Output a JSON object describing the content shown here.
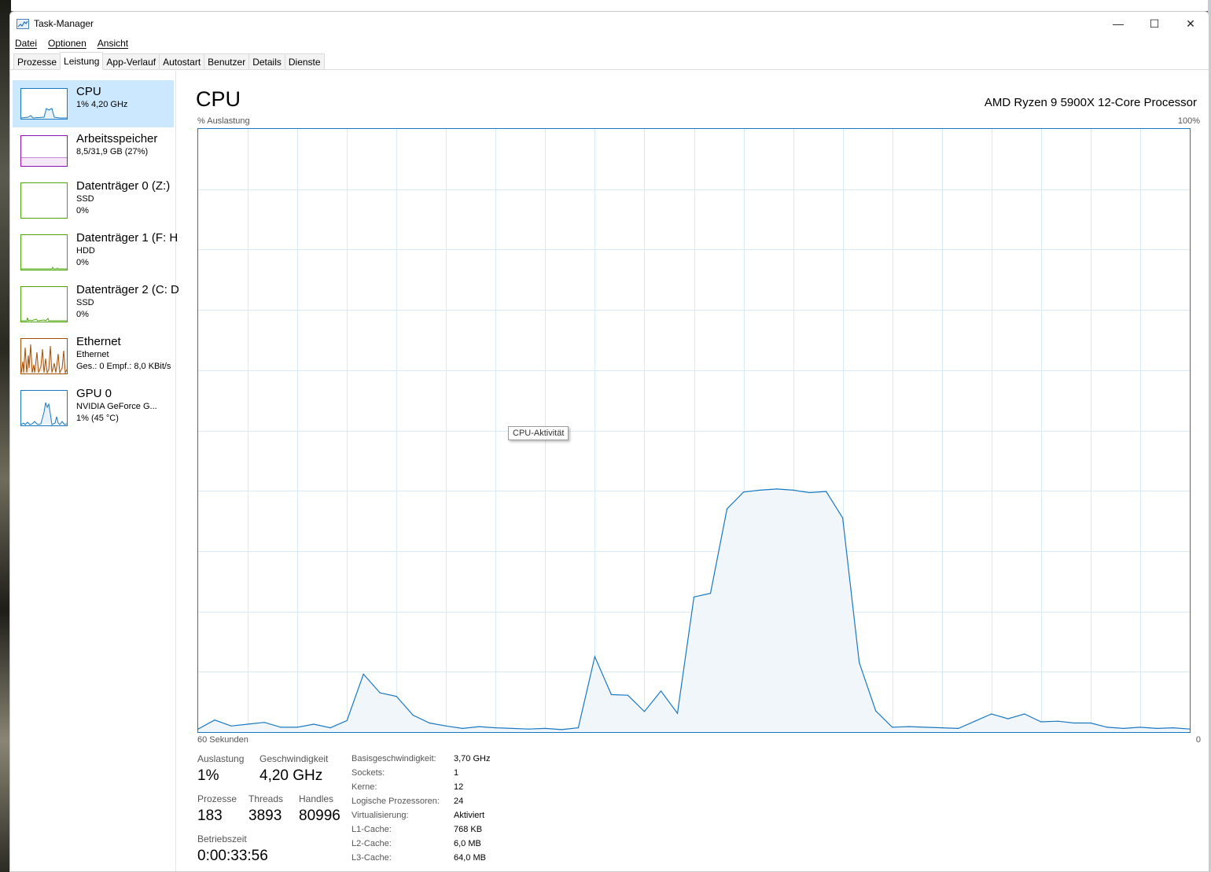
{
  "window": {
    "title": "Task-Manager",
    "controls": {
      "minimize": "—",
      "maximize": "☐",
      "close": "✕"
    }
  },
  "menu": [
    "Datei",
    "Optionen",
    "Ansicht"
  ],
  "tabs": [
    "Prozesse",
    "Leistung",
    "App-Verlauf",
    "Autostart",
    "Benutzer",
    "Details",
    "Dienste"
  ],
  "active_tab": "Leistung",
  "sidebar": {
    "items": [
      {
        "title": "CPU",
        "line1": "1%  4,20 GHz",
        "line2": "",
        "color": "#1978c2",
        "selected": true
      },
      {
        "title": "Arbeitsspeicher",
        "line1": "8,5/31,9 GB (27%)",
        "line2": "",
        "color": "#8b12ae",
        "selected": false
      },
      {
        "title": "Datenträger 0 (Z:)",
        "line1": "SSD",
        "line2": "0%",
        "color": "#4da60c",
        "selected": false
      },
      {
        "title": "Datenträger 1 (F: H",
        "line1": "HDD",
        "line2": "0%",
        "color": "#4da60c",
        "selected": false
      },
      {
        "title": "Datenträger 2 (C: D",
        "line1": "SSD",
        "line2": "0%",
        "color": "#4da60c",
        "selected": false
      },
      {
        "title": "Ethernet",
        "line1": "Ethernet",
        "line2": "Ges.: 0  Empf.: 8,0 KBit/s",
        "color": "#a74f01",
        "selected": false
      },
      {
        "title": "GPU 0",
        "line1": "NVIDIA GeForce G...",
        "line2": "1%  (45 °C)",
        "color": "#1978c2",
        "selected": false
      }
    ]
  },
  "main": {
    "title": "CPU",
    "model": "AMD Ryzen 9 5900X 12-Core Processor",
    "y_axis_label": "% Auslastung",
    "y_axis_max": "100%",
    "x_axis_left": "60 Sekunden",
    "x_axis_right": "0",
    "tooltip": "CPU-Aktivität"
  },
  "stats": {
    "auslastung_label": "Auslastung",
    "auslastung": "1%",
    "geschwindigkeit_label": "Geschwindigkeit",
    "geschwindigkeit": "4,20 GHz",
    "prozesse_label": "Prozesse",
    "prozesse": "183",
    "threads_label": "Threads",
    "threads": "3893",
    "handles_label": "Handles",
    "handles": "80996",
    "betriebszeit_label": "Betriebszeit",
    "betriebszeit": "0:00:33:56"
  },
  "info": [
    {
      "label": "Basisgeschwindigkeit:",
      "value": "3,70 GHz"
    },
    {
      "label": "Sockets:",
      "value": "1"
    },
    {
      "label": "Kerne:",
      "value": "12"
    },
    {
      "label": "Logische Prozessoren:",
      "value": "24"
    },
    {
      "label": "Virtualisierung:",
      "value": "Aktiviert"
    },
    {
      "label": "L1-Cache:",
      "value": "768 KB"
    },
    {
      "label": "L2-Cache:",
      "value": "6,0 MB"
    },
    {
      "label": "L3-Cache:",
      "value": "64,0 MB"
    }
  ],
  "chart_data": {
    "type": "area",
    "y_unit": "% Auslastung",
    "ylim": [
      0,
      100
    ],
    "x_seconds_ago": [
      60,
      59,
      58,
      57,
      56,
      55,
      54,
      53,
      52,
      51,
      50,
      49,
      48,
      47,
      46,
      45,
      44,
      43,
      42,
      41,
      40,
      39,
      38,
      37,
      36,
      35,
      34,
      33,
      32,
      31,
      30,
      29,
      28,
      27,
      26,
      25,
      24,
      23,
      22,
      21,
      20,
      19,
      18,
      17,
      16,
      15,
      14,
      13,
      12,
      11,
      10,
      9,
      8,
      7,
      6,
      5,
      4,
      3,
      2,
      1,
      0
    ],
    "values": [
      0.5,
      2,
      1,
      1.3,
      1.6,
      0.8,
      0.8,
      1.3,
      0.7,
      1.9,
      9.6,
      6.5,
      5.9,
      2.8,
      1.5,
      1,
      0.6,
      0.9,
      0.7,
      0.6,
      0.5,
      0.6,
      0.4,
      0.7,
      12.5,
      6.2,
      6.1,
      3.4,
      6.8,
      3.1,
      22.4,
      23,
      37,
      39.8,
      40.1,
      40.3,
      40.1,
      39.7,
      39.9,
      35.5,
      11.5,
      3.5,
      0.8,
      0.9,
      0.8,
      0.7,
      0.6,
      1.8,
      3,
      2.2,
      3,
      1.7,
      1.8,
      1.5,
      1.5,
      0.8,
      0.6,
      0.8,
      0.6,
      0.7,
      0.5
    ],
    "grid": true,
    "line_color": "#1978c2",
    "fill_color": "#f1f6fa",
    "grid_color": "#d9eaf7"
  }
}
